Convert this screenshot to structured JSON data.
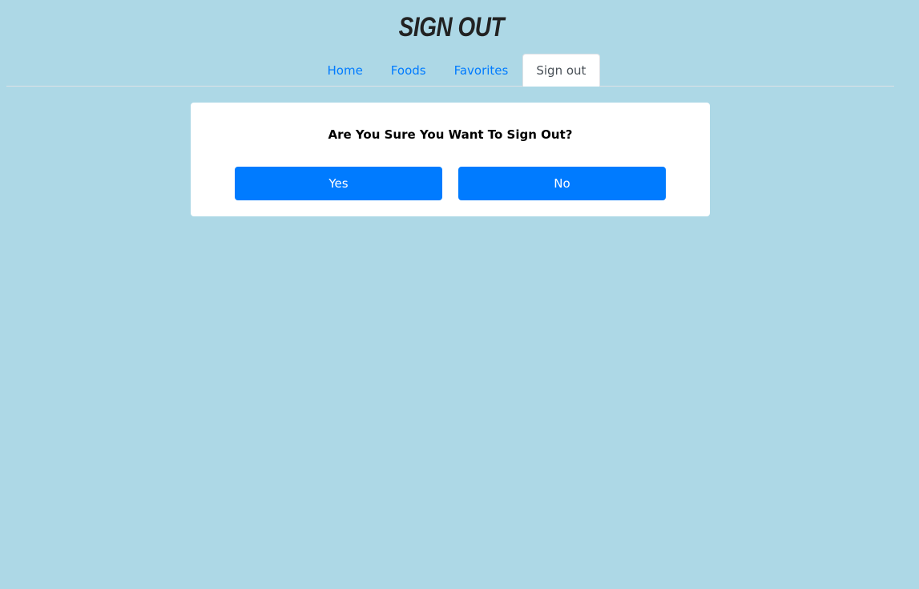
{
  "header": {
    "title": "SIGN OUT"
  },
  "nav": {
    "items": [
      {
        "label": "Home",
        "active": false
      },
      {
        "label": "Foods",
        "active": false
      },
      {
        "label": "Favorites",
        "active": false
      },
      {
        "label": "Sign out",
        "active": true
      }
    ]
  },
  "dialog": {
    "question": "Are You Sure You Want To Sign Out?",
    "yes_label": "Yes",
    "no_label": "No"
  },
  "colors": {
    "background": "#add8e6",
    "accent": "#007bff",
    "card": "#ffffff"
  }
}
